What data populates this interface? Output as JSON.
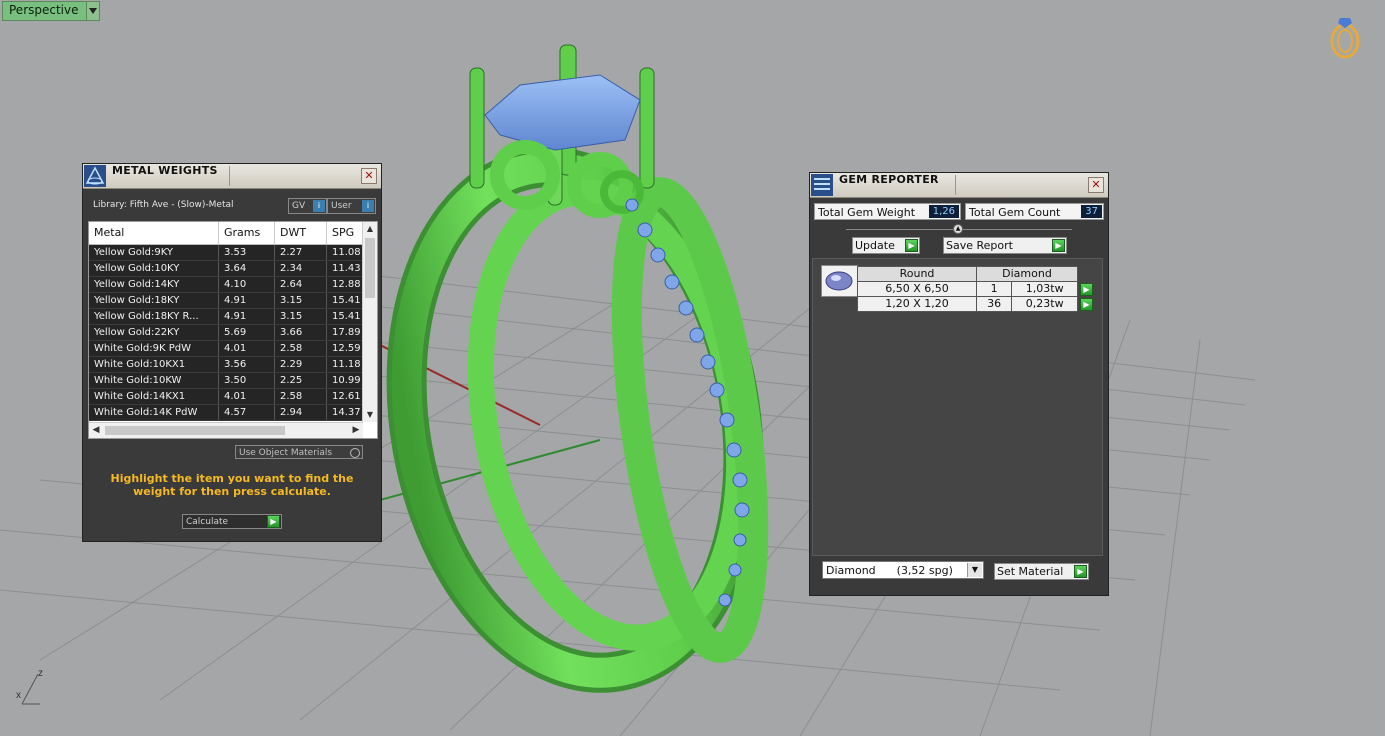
{
  "viewport": {
    "label": "Perspective",
    "axis_labels": {
      "z": "z",
      "x": "x"
    }
  },
  "metal_weights": {
    "title": "METAL WEIGHTS",
    "library": "Library: Fifth Ave - (Slow)-Metal",
    "gv_label": "GV",
    "user_label": "User",
    "columns": [
      "Metal",
      "Grams",
      "DWT",
      "SPG"
    ],
    "rows": [
      {
        "metal": "Yellow Gold:9KY",
        "grams": "3.53",
        "dwt": "2.27",
        "spg": "11.08"
      },
      {
        "metal": "Yellow Gold:10KY",
        "grams": "3.64",
        "dwt": "2.34",
        "spg": "11.43"
      },
      {
        "metal": "Yellow Gold:14KY",
        "grams": "4.10",
        "dwt": "2.64",
        "spg": "12.88"
      },
      {
        "metal": "Yellow Gold:18KY",
        "grams": "4.91",
        "dwt": "3.15",
        "spg": "15.41"
      },
      {
        "metal": "Yellow Gold:18KY R...",
        "grams": "4.91",
        "dwt": "3.15",
        "spg": "15.41"
      },
      {
        "metal": "Yellow Gold:22KY",
        "grams": "5.69",
        "dwt": "3.66",
        "spg": "17.89"
      },
      {
        "metal": "White Gold:9K PdW",
        "grams": "4.01",
        "dwt": "2.58",
        "spg": "12.59"
      },
      {
        "metal": "White Gold:10KX1",
        "grams": "3.56",
        "dwt": "2.29",
        "spg": "11.18"
      },
      {
        "metal": "White Gold:10KW",
        "grams": "3.50",
        "dwt": "2.25",
        "spg": "10.99"
      },
      {
        "metal": "White Gold:14KX1",
        "grams": "4.01",
        "dwt": "2.58",
        "spg": "12.61"
      },
      {
        "metal": "White Gold:14K PdW",
        "grams": "4.57",
        "dwt": "2.94",
        "spg": "14.37"
      }
    ],
    "use_object_materials": "Use Object Materials",
    "hint": "Highlight the item you want to find the weight for then press calculate.",
    "calculate": "Calculate"
  },
  "gem_reporter": {
    "title": "GEM REPORTER",
    "total_weight_label": "Total Gem Weight",
    "total_weight_value": "1,26",
    "total_count_label": "Total Gem Count",
    "total_count_value": "37",
    "update": "Update",
    "save_report": "Save Report",
    "shape_header": "Round",
    "material_header": "Diamond",
    "gems": [
      {
        "size": "6,50 X 6,50",
        "count": "1",
        "weight": "1,03tw"
      },
      {
        "size": "1,20 X 1,20",
        "count": "36",
        "weight": "0,23tw"
      }
    ],
    "material_select": "Diamond      (3,52 spg)",
    "set_material": "Set Material"
  },
  "colors": {
    "ring_green": "#6fdc5a",
    "gem_blue": "#7ea6e8",
    "hint_yellow": "#f5b922",
    "panel_dark": "#3a3a3a"
  }
}
